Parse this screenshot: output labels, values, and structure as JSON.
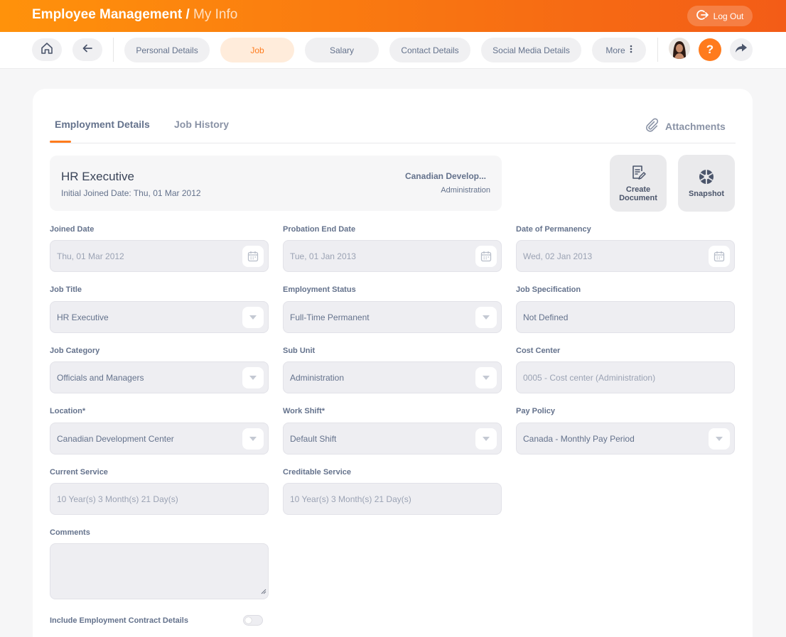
{
  "header": {
    "title": "Employee Management",
    "separator": " / ",
    "subtitle": "My Info",
    "logout_label": "Log Out"
  },
  "nav": {
    "tabs": [
      {
        "label": "Personal Details",
        "active": false
      },
      {
        "label": "Job",
        "active": true
      },
      {
        "label": "Salary",
        "active": false
      },
      {
        "label": "Contact Details",
        "active": false
      },
      {
        "label": "Social Media Details",
        "active": false
      },
      {
        "label": "More",
        "active": false
      }
    ],
    "help_label": "?"
  },
  "card": {
    "tabs": [
      {
        "label": "Employment Details",
        "active": true
      },
      {
        "label": "Job History",
        "active": false
      }
    ],
    "attachments_label": "Attachments",
    "summary": {
      "job_title": "HR Executive",
      "initial_joined": "Initial Joined Date: Thu, 01 Mar 2012",
      "location": "Canadian Develop...",
      "sub_unit": "Administration"
    },
    "actions": {
      "create_document": "Create Document",
      "snapshot": "Snapshot"
    }
  },
  "form": {
    "joined_date": {
      "label": "Joined Date",
      "value": "Thu, 01 Mar 2012"
    },
    "probation_end_date": {
      "label": "Probation End Date",
      "value": "Tue, 01 Jan 2013"
    },
    "date_of_permanency": {
      "label": "Date of Permanency",
      "value": "Wed, 02 Jan 2013"
    },
    "job_title": {
      "label": "Job Title",
      "value": "HR Executive"
    },
    "employment_status": {
      "label": "Employment Status",
      "value": "Full-Time Permanent"
    },
    "job_specification": {
      "label": "Job Specification",
      "value": "Not Defined"
    },
    "job_category": {
      "label": "Job Category",
      "value": "Officials and Managers"
    },
    "sub_unit": {
      "label": "Sub Unit",
      "value": "Administration"
    },
    "cost_center": {
      "label": "Cost Center",
      "value": "0005 - Cost center (Administration)"
    },
    "location": {
      "label": "Location*",
      "value": "Canadian Development Center"
    },
    "work_shift": {
      "label": "Work Shift*",
      "value": "Default Shift"
    },
    "pay_policy": {
      "label": "Pay Policy",
      "value": "Canada - Monthly Pay Period"
    },
    "current_service": {
      "label": "Current Service",
      "value": "10 Year(s) 3 Month(s) 21 Day(s)"
    },
    "creditable_service": {
      "label": "Creditable Service",
      "value": "10 Year(s) 3 Month(s) 21 Day(s)"
    },
    "comments": {
      "label": "Comments",
      "value": ""
    },
    "include_contract": {
      "label": "Include Employment Contract Details",
      "enabled": false
    }
  },
  "colors": {
    "accent": "#ff7b1d",
    "header_start": "#ff920b",
    "header_end": "#f35c17"
  }
}
